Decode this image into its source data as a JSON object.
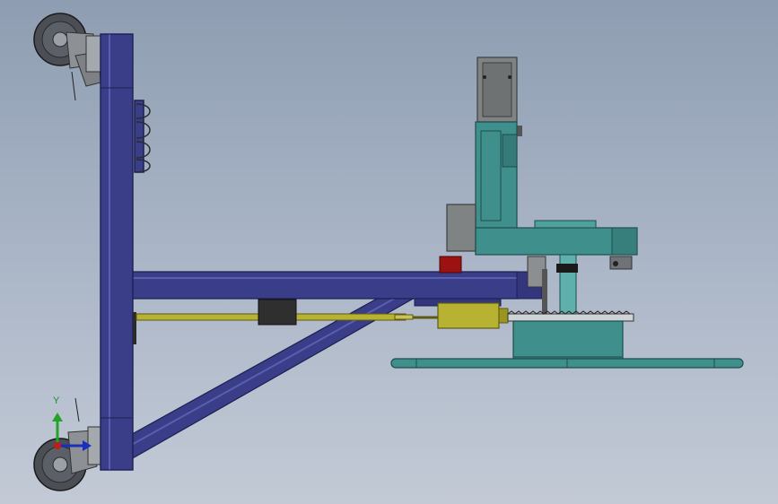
{
  "viewport": {
    "background_top": "#8e9db1",
    "background_bottom": "#c3cad6"
  },
  "colors": {
    "frame": "#3a3d88",
    "frame_edge": "#1d1f52",
    "teal": "#3f8f8c",
    "teal_edge": "#1e4d4b",
    "motor_gray": "#7f8384",
    "motor_edge": "#3d3f40",
    "olive": "#b8b232",
    "olive_edge": "#5e5a12",
    "red_block": "#9c1212",
    "wheel": "#4b4f55",
    "black": "#1a1a1a"
  },
  "triad": {
    "y_axis": "Y",
    "y_color": "#22a32a",
    "x_color": "#1b2fbf",
    "z_color": "#c41a1a"
  },
  "model": {
    "components": [
      "upright-column",
      "horizontal-boom",
      "diagonal-brace",
      "top-caster-wheel",
      "bottom-caster-wheel",
      "cable-hook-bracket",
      "servo-motor",
      "teal-mast",
      "teal-arm",
      "gearbox",
      "linear-actuator",
      "turntable-gear",
      "suction-bar"
    ]
  }
}
